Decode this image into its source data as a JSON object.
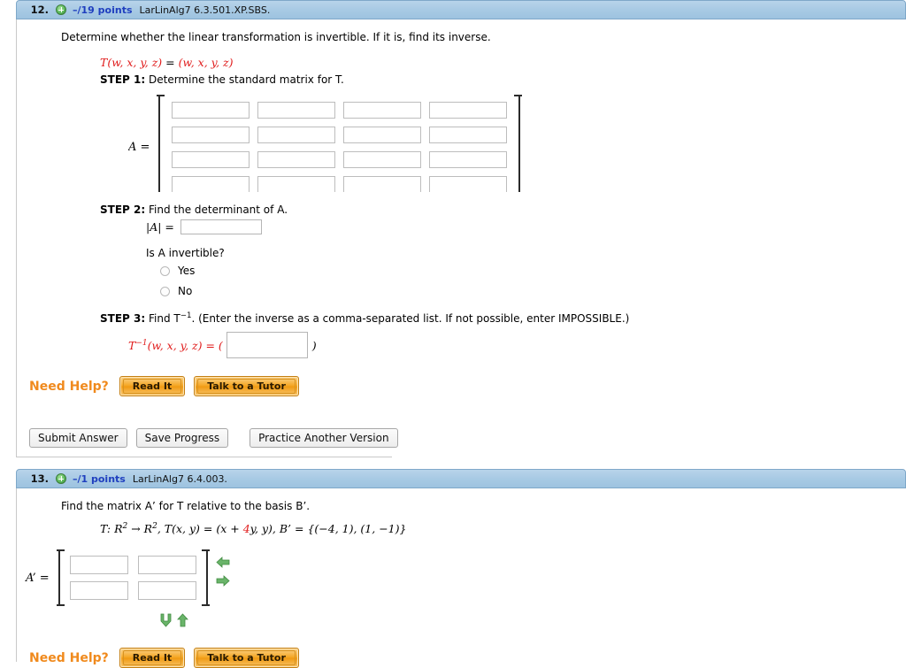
{
  "colors": {
    "header_bar": "#a8cae4",
    "points_text": "#1f3fbf",
    "formula_red": "#e01b1b",
    "need_help_orange": "#f08a1d",
    "arrow_green": "#5aa85a"
  },
  "questions": [
    {
      "number": "12.",
      "plus_icon": "plus-circle-icon",
      "points": "–/19 points",
      "code": "LarLinAlg7 6.3.501.XP.SBS.",
      "prompt": "Determine whether the linear transformation is invertible. If it is, find its inverse.",
      "transformation": {
        "lhs": "T(w, x, y, z)",
        "eq": "=",
        "rhs": "(w, x, y, z)"
      },
      "steps": [
        {
          "label": "STEP 1:",
          "text": "Determine the standard matrix for T."
        },
        {
          "label": "STEP 2:",
          "text": "Find the determinant of A."
        },
        {
          "label": "STEP 3:",
          "text": "Find T–1. (Enter the inverse as a comma-separated list. If not possible, enter IMPOSSIBLE.)"
        }
      ],
      "step1": {
        "matrix_label": "A =",
        "rows": 4,
        "cols": 4,
        "cells": [
          [
            "",
            "",
            "",
            ""
          ],
          [
            "",
            "",
            "",
            ""
          ],
          [
            "",
            "",
            "",
            ""
          ],
          [
            "",
            "",
            "",
            ""
          ]
        ]
      },
      "step2": {
        "det_label": "|A| =",
        "det_value": "",
        "question": "Is A invertible?",
        "options": [
          {
            "label": "Yes",
            "selected": false
          },
          {
            "label": "No",
            "selected": false
          }
        ]
      },
      "step3": {
        "lhs": "T–1(w, x, y, z) = (",
        "value": "",
        "rhs": ")"
      },
      "need_help": {
        "label": "Need Help?",
        "buttons": [
          "Read It",
          "Talk to a Tutor"
        ]
      },
      "actions": [
        "Submit Answer",
        "Save Progress",
        "Practice Another Version"
      ]
    },
    {
      "number": "13.",
      "plus_icon": "plus-circle-icon",
      "points": "–/1 points",
      "code": "LarLinAlg7 6.4.003.",
      "prompt": "Find the matrix A’ for T relative to the basis B’.",
      "given": {
        "part1": "T: R2 → R2, T(x, y) = (x + ",
        "red": "4",
        "part2": "y, y), B’ = {(−4, 1), (1, −1)}"
      },
      "matrix": {
        "matrix_label": "A’ =",
        "rows": 2,
        "cols": 2,
        "cells": [
          [
            "",
            ""
          ],
          [
            "",
            ""
          ]
        ]
      },
      "arrows": {
        "left": "arrow-left-icon",
        "right": "arrow-right-icon",
        "down": "arrow-down-icon",
        "up": "arrow-up-icon"
      },
      "need_help": {
        "label": "Need Help?",
        "buttons": [
          "Read It",
          "Talk to a Tutor"
        ]
      }
    }
  ]
}
